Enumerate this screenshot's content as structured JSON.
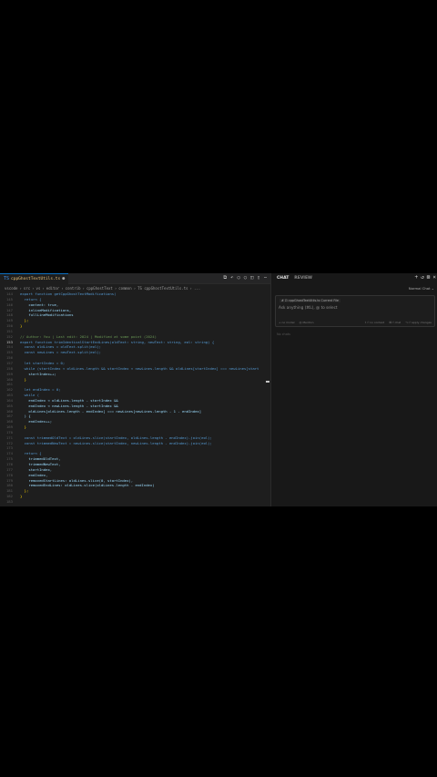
{
  "editor": {
    "tab": {
      "icon": "ts-file-icon",
      "label": "cppGhostTextUtils.ts",
      "modified": "9+"
    },
    "breadcrumb": [
      "vscode",
      "src",
      "vs",
      "editor",
      "contrib",
      "cppGhostText",
      "common",
      "TS cppGhostTextUtils.ts",
      "..."
    ],
    "toolbar_icons": [
      "compare-icon",
      "go-back-icon",
      "circle-icon",
      "circle-icon",
      "split-editor-icon",
      "more-icon"
    ]
  },
  "code_lines": [
    {
      "n": "144",
      "t": "export function getCppGhostTextModifications("
    },
    {
      "n": "145",
      "t": "  return {"
    },
    {
      "n": "146",
      "t": "    content: true,"
    },
    {
      "n": "147",
      "t": "    inlineModifications,"
    },
    {
      "n": "148",
      "t": "    fullLineModifications"
    },
    {
      "n": "149",
      "t": "  };"
    },
    {
      "n": "150",
      "t": "}"
    },
    {
      "n": "151",
      "t": ""
    },
    {
      "n": "152",
      "t": "// Author: You | Last edit: 2024 | Modified at some point (2024)"
    },
    {
      "n": "153",
      "t": "export function trimIdenticalStartEndLines(oldText: string, newText: string, eol: string) {"
    },
    {
      "n": "154",
      "t": "  const oldLines = oldText.split(eol);"
    },
    {
      "n": "155",
      "t": "  const newLines = newText.split(eol);"
    },
    {
      "n": "156",
      "t": ""
    },
    {
      "n": "157",
      "t": "  let startIndex = 0;"
    },
    {
      "n": "158",
      "t": "  while (startIndex < oldLines.length && startIndex < newLines.length && oldLines[startIndex] === newLines[start"
    },
    {
      "n": "159",
      "t": "    startIndex++;"
    },
    {
      "n": "160",
      "t": "  }"
    },
    {
      "n": "161",
      "t": ""
    },
    {
      "n": "162",
      "t": "  let endIndex = 0;"
    },
    {
      "n": "163",
      "t": "  while ("
    },
    {
      "n": "164",
      "t": "    endIndex < oldLines.length - startIndex &&"
    },
    {
      "n": "165",
      "t": "    endIndex < newLines.length - startIndex &&"
    },
    {
      "n": "166",
      "t": "    oldLines[oldLines.length - endIndex] === newLines[newLines.length - 1 - endIndex]"
    },
    {
      "n": "167",
      "t": "  ) {"
    },
    {
      "n": "168",
      "t": "    endIndex++;"
    },
    {
      "n": "169",
      "t": "  }"
    },
    {
      "n": "170",
      "t": ""
    },
    {
      "n": "171",
      "t": "  const trimmedOldText = oldLines.slice(startIndex, oldLines.length - endIndex).join(eol);"
    },
    {
      "n": "172",
      "t": "  const trimmedNewText = newLines.slice(startIndex, newLines.length - endIndex).join(eol);"
    },
    {
      "n": "173",
      "t": ""
    },
    {
      "n": "174",
      "t": "  return {"
    },
    {
      "n": "175",
      "t": "    trimmedOldText,"
    },
    {
      "n": "176",
      "t": "    trimmedNewText,"
    },
    {
      "n": "177",
      "t": "    startIndex,"
    },
    {
      "n": "178",
      "t": "    endIndex,"
    },
    {
      "n": "179",
      "t": "    removedStartLines: oldLines.slice(0, startIndex),"
    },
    {
      "n": "180",
      "t": "    removedEndLines: oldLines.slice(oldLines.length - endIndex)"
    },
    {
      "n": "181",
      "t": "  };"
    },
    {
      "n": "182",
      "t": "}"
    },
    {
      "n": "183",
      "t": ""
    }
  ],
  "chat": {
    "tabs": [
      "CHAT",
      "REVIEW"
    ],
    "header_icons": [
      "plus-icon",
      "history-icon",
      "expand-icon",
      "close-icon"
    ],
    "new_chat_label": "Normal Chat ⌄",
    "context_chip": "# ⊡ cppGhostTextUtils.ts Current File",
    "placeholder": "Ask anything (⌘L), @ to select",
    "footer_left": [
      "+ no model",
      "@ Mention"
    ],
    "footer_right": [
      "⇧⏎ no context",
      "⌘⏎ chat",
      "⌥⏎ apply changes"
    ],
    "history_label": "No chats"
  },
  "colors": {
    "background": "#1e1e1e",
    "keyword": "#569cd6",
    "control": "#c586c0",
    "function": "#dcdcaa",
    "type": "#4ec9b0",
    "variable": "#9cdcfe",
    "comment": "#6a9955",
    "accent": "#0e70c0"
  }
}
